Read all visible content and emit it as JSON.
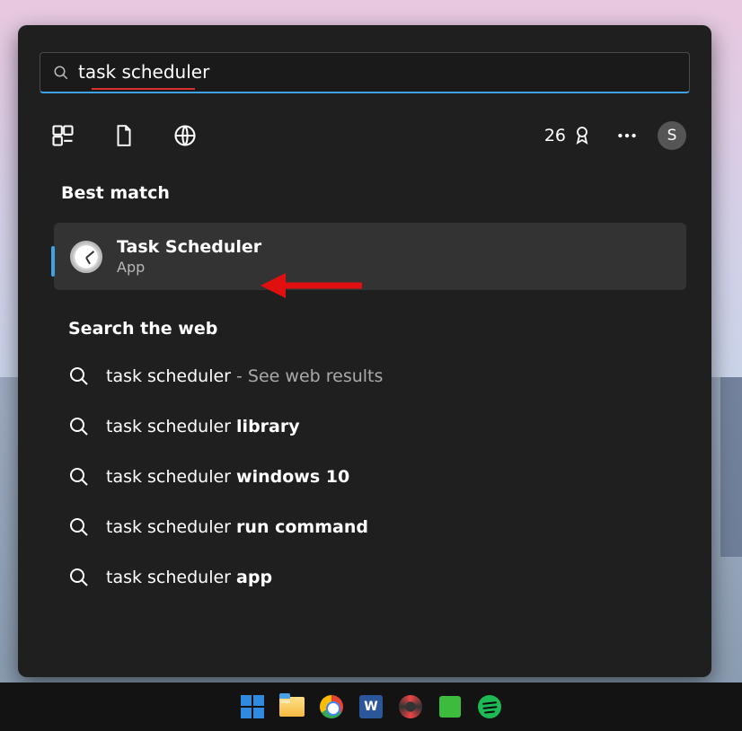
{
  "search": {
    "value": "task scheduler"
  },
  "tabs": {
    "points": "26"
  },
  "avatar": {
    "initial": "S"
  },
  "sections": {
    "best_match": "Best match",
    "web": "Search the web"
  },
  "best_match": {
    "title": "Task Scheduler",
    "subtitle": "App"
  },
  "web_results": [
    {
      "prefix": "task scheduler",
      "bold": "",
      "suffix": " - See web results"
    },
    {
      "prefix": "task scheduler ",
      "bold": "library",
      "suffix": ""
    },
    {
      "prefix": "task scheduler ",
      "bold": "windows 10",
      "suffix": ""
    },
    {
      "prefix": "task scheduler ",
      "bold": "run command",
      "suffix": ""
    },
    {
      "prefix": "task scheduler ",
      "bold": "app",
      "suffix": ""
    }
  ],
  "taskbar": {
    "word_letter": "W"
  }
}
